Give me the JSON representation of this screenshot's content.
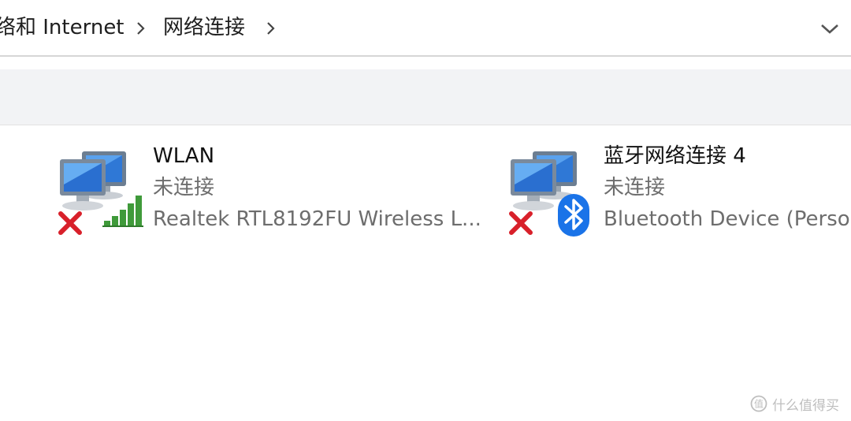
{
  "address_bar": {
    "breadcrumbs": [
      {
        "label": "络和 Internet"
      },
      {
        "label": "网络连接"
      }
    ]
  },
  "connections": [
    {
      "name": "WLAN",
      "status": "未连接",
      "device": "Realtek RTL8192FU Wireless L...",
      "icon": "wifi-signal-icon",
      "overlay": "red-x-icon"
    },
    {
      "name": "蓝牙网络连接 4",
      "status": "未连接",
      "device": "Bluetooth Device (Personal Area Network)",
      "icon": "bluetooth-icon",
      "overlay": "red-x-icon"
    }
  ],
  "watermark": {
    "text": "什么值得买"
  },
  "colors": {
    "toolbar_bg": "#f2f3f5",
    "status_text": "#6d6d6d",
    "error_red": "#d8202a",
    "bluetooth_blue": "#1a73e8",
    "signal_green": "#3f9a3a"
  }
}
